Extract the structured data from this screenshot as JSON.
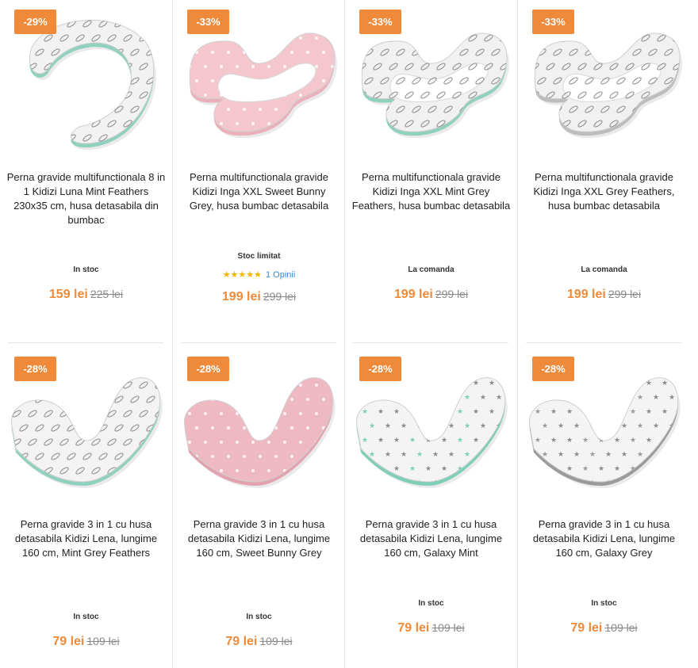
{
  "products": [
    {
      "badge": "-29%",
      "title": "Perna gravide multifunctionala 8 in 1 Kidizi Luna Mint Feathers 230x35 cm, husa detasabila din bumbac",
      "stock": "In stoc",
      "price_new": "159 lei",
      "price_old": "225 lei",
      "pillow_shape": "c-shape",
      "pillow_color": "#f2f2f2",
      "accent_color": "#8fd1be",
      "pattern_icon": "feather-pattern-icon"
    },
    {
      "badge": "-33%",
      "title": "Perna multifunctionala gravide Kidizi Inga XXL Sweet Bunny Grey, husa bumbac detasabila",
      "stock": "Stoc limitat",
      "stars": "★★★★★",
      "opinions": "1 Opinii",
      "price_new": "199 lei",
      "price_old": "299 lei",
      "pillow_shape": "u-shape",
      "pillow_color": "#f4c7cf",
      "accent_color": "#eab1bc",
      "pattern_icon": "bunny-pattern-icon"
    },
    {
      "badge": "-33%",
      "title": "Perna multifunctionala gravide Kidizi Inga XXL Mint Grey Feathers, husa bumbac detasabila",
      "stock": "La comanda",
      "price_new": "199 lei",
      "price_old": "299 lei",
      "pillow_shape": "u-shape",
      "pillow_color": "#f1f1f1",
      "accent_color": "#8fd1be",
      "pattern_icon": "feather-pattern-icon"
    },
    {
      "badge": "-33%",
      "title": "Perna multifunctionala gravide Kidizi Inga XXL Grey Feathers, husa bumbac detasabila",
      "stock": "La comanda",
      "price_new": "199 lei",
      "price_old": "299 lei",
      "pillow_shape": "u-shape",
      "pillow_color": "#f1f1f1",
      "accent_color": "#bdbdbd",
      "pattern_icon": "feather-pattern-icon"
    },
    {
      "badge": "-28%",
      "title": "Perna gravide 3 in 1 cu husa detasabila Kidizi Lena, lungime 160 cm, Mint Grey Feathers",
      "stock": "In stoc",
      "price_new": "79 lei",
      "price_old": "109 lei",
      "pillow_shape": "v-shape",
      "pillow_color": "#f3f3f3",
      "accent_color": "#8fd1be",
      "pattern_icon": "feather-pattern-icon"
    },
    {
      "badge": "-28%",
      "title": "Perna gravide 3 in 1 cu husa detasabila Kidizi Lena, lungime 160 cm, Sweet Bunny Grey",
      "stock": "In stoc",
      "price_new": "79 lei",
      "price_old": "109 lei",
      "pillow_shape": "v-shape",
      "pillow_color": "#efb9c4",
      "accent_color": "#e3a2b0",
      "pattern_icon": "bunny-pattern-icon"
    },
    {
      "badge": "-28%",
      "title": "Perna gravide 3 in 1 cu husa detasabila Kidizi Lena, lungime 160 cm, Galaxy Mint",
      "stock": "In stoc",
      "price_new": "79 lei",
      "price_old": "109 lei",
      "pillow_shape": "v-shape",
      "pillow_color": "#f4f4f4",
      "accent_color": "#7fcfb8",
      "pattern_icon": "star-pattern-icon"
    },
    {
      "badge": "-28%",
      "title": "Perna gravide 3 in 1 cu husa detasabila Kidizi Lena, lungime 160 cm, Galaxy Grey",
      "stock": "In stoc",
      "price_new": "79 lei",
      "price_old": "109 lei",
      "pillow_shape": "v-shape",
      "pillow_color": "#f4f4f4",
      "accent_color": "#9a9a9a",
      "pattern_icon": "star-pattern-icon"
    }
  ],
  "colors": {
    "accent": "#ef8a3a",
    "link": "#3a8ad6",
    "star": "#f5b400",
    "divider": "#e6e6e6"
  }
}
